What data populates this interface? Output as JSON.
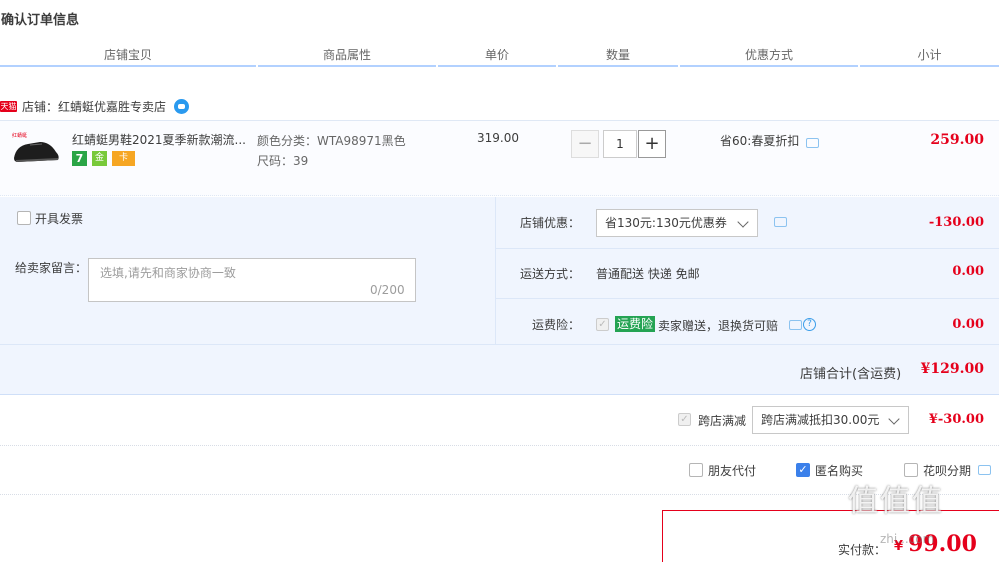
{
  "page": {
    "title": "确认订单信息"
  },
  "columns": [
    "店铺宝贝",
    "商品属性",
    "单价",
    "数量",
    "优惠方式",
    "小计"
  ],
  "shop": {
    "badge": "天猫",
    "label": "店铺：红蜻蜓优嘉胜专卖店"
  },
  "item": {
    "title": "红蜻蜓男鞋2021夏季新款潮流...",
    "attr_color": "颜色分类：WTA98971黑色",
    "attr_size": "尺码：39",
    "unit_price": "319.00",
    "quantity": "1",
    "qty_minus": "−",
    "qty_plus": "+",
    "promo": "省60:春夏折扣",
    "subtotal": "259.00",
    "badges": [
      "7",
      "金",
      "卡"
    ]
  },
  "invoice": {
    "label": "开具发票",
    "checked": false
  },
  "remark": {
    "label": "给卖家留言：",
    "placeholder": "选填,请先和商家协商一致",
    "count": "0/200"
  },
  "shop_discount": {
    "label": "店铺优惠：",
    "selected": "省130元:130元优惠券",
    "amount": "-130.00"
  },
  "shipping": {
    "label": "运送方式：",
    "value": "普通配送 快递 免邮",
    "amount": "0.00"
  },
  "insurance": {
    "label": "运费险：",
    "tag": "运费险",
    "desc": "卖家赠送，退换货可赔",
    "amount": "0.00",
    "help": "?"
  },
  "shop_total": {
    "label": "店铺合计(含运费)",
    "amount": "¥129.00"
  },
  "cross_shop": {
    "label": "跨店满减",
    "selected": "跨店满减抵扣30.00元",
    "amount": "¥-30.00"
  },
  "options": [
    {
      "label": "朋友代付",
      "checked": false
    },
    {
      "label": "匿名购买",
      "checked": true
    },
    {
      "label": "花呗分期",
      "checked": false
    }
  ],
  "payment": {
    "label": "实付款：",
    "amount": "99.00",
    "currency": "¥"
  },
  "watermark": {
    "text": "值值值",
    "sub": "zhi...com"
  },
  "colors": {
    "price_red": "#e5001b",
    "panel_bg": "#f0f5fe",
    "accent_blue": "#3b80ea",
    "insure_green": "#24a353"
  }
}
